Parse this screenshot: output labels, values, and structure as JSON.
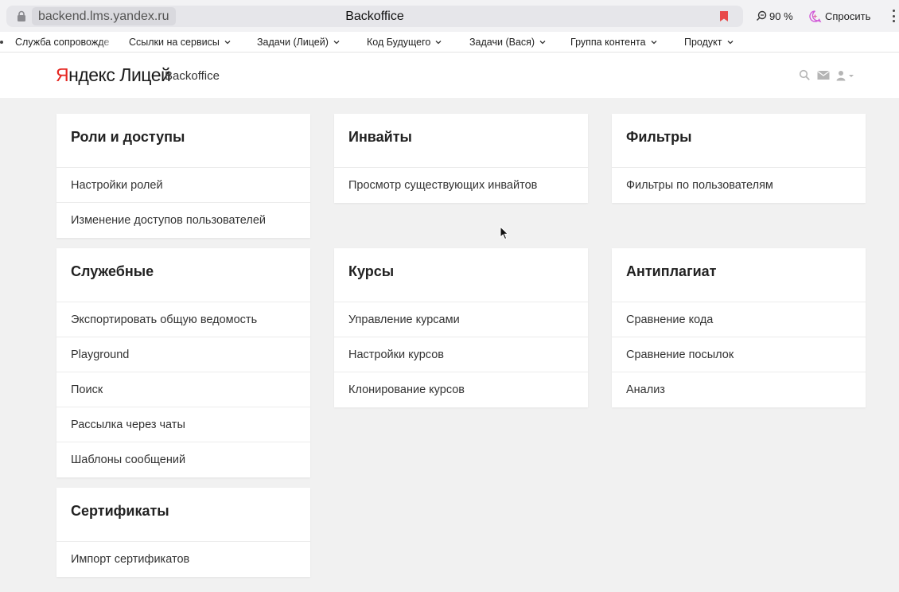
{
  "browser": {
    "url": "backend.lms.yandex.ru",
    "tab_title": "Backoffice",
    "zoom": "90 %",
    "ask_label": "Спросить",
    "accent": "#e84a4a"
  },
  "bookmarks": [
    {
      "label": "Служба сопровожде",
      "dropdown": false
    },
    {
      "label": "Ссылки на сервисы",
      "dropdown": true
    },
    {
      "label": "Задачи (Лицей)",
      "dropdown": true
    },
    {
      "label": "Код Будущего",
      "dropdown": true
    },
    {
      "label": "Задачи (Вася)",
      "dropdown": true
    },
    {
      "label": "Группа контента",
      "dropdown": true
    },
    {
      "label": "Продукт",
      "dropdown": true
    }
  ],
  "header": {
    "logo_y": "Я",
    "logo_ndex": "ндекс",
    "logo_product": "Лицей",
    "section": "Backoffice",
    "icons": [
      "search-icon",
      "mail-icon",
      "user-icon"
    ]
  },
  "cards": [
    {
      "title": "Роли и доступы",
      "items": [
        "Настройки ролей",
        "Изменение доступов пользователей"
      ]
    },
    {
      "title": "Инвайты",
      "items": [
        "Просмотр существующих инвайтов"
      ]
    },
    {
      "title": "Фильтры",
      "items": [
        "Фильтры по пользователям"
      ]
    },
    {
      "title": "Служебные",
      "items": [
        "Экспортировать общую ведомость",
        "Playground",
        "Поиск",
        "Рассылка через чаты",
        "Шаблоны сообщений"
      ]
    },
    {
      "title": "Курсы",
      "items": [
        "Управление курсами",
        "Настройки курсов",
        "Клонирование курсов"
      ]
    },
    {
      "title": "Антиплагиат",
      "items": [
        "Сравнение кода",
        "Сравнение посылок",
        "Анализ"
      ]
    },
    {
      "title": "Сертификаты",
      "items": [
        "Импорт сертификатов"
      ]
    }
  ]
}
